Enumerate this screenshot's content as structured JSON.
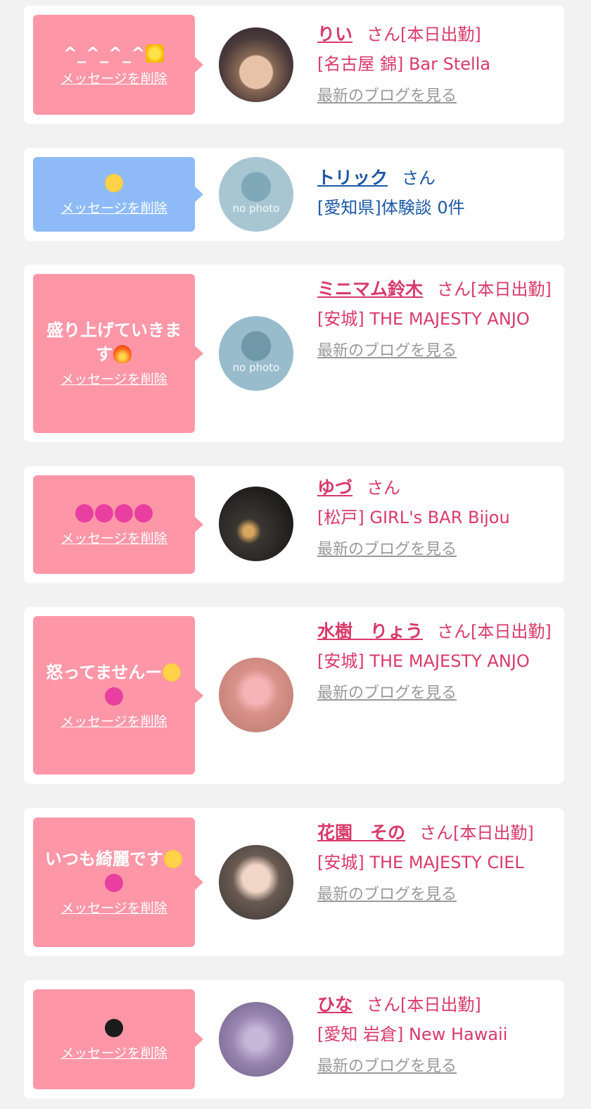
{
  "delete_label": "メッセージを削除",
  "san_label": "さん",
  "blog_label": "最新のブログを見る",
  "no_photo_label": "no photo",
  "cards": [
    {
      "message": "^_^_^_^",
      "emoji": "star",
      "name": "りい",
      "suffix": "[本日出勤]",
      "shop": "[名古屋 錦] Bar Stella"
    },
    {
      "message": "",
      "emoji": "kiss",
      "name": "トリック",
      "suffix": "",
      "shop": "[愛知県]体験談 0件"
    },
    {
      "message": "盛り上げていきます",
      "emoji": "fire",
      "name": "ミニマム鈴木",
      "suffix": "[本日出勤]",
      "shop": "[安城] THE MAJESTY ANJO"
    },
    {
      "message": "",
      "emoji": "hearts",
      "name": "ゆづ",
      "suffix": "",
      "shop": "[松戸] GIRL's BAR Bijou"
    },
    {
      "message": "怒ってませんー",
      "emoji": "pleading-heart",
      "name": "水樹　りょう",
      "suffix": "[本日出勤]",
      "shop": "[安城] THE MAJESTY ANJO"
    },
    {
      "message": "いつも綺麗です",
      "emoji": "smile-heart",
      "name": "花園　その",
      "suffix": "[本日出勤]",
      "shop": "[安城] THE MAJESTY CIEL"
    },
    {
      "message": "",
      "emoji": "black-heart",
      "name": "ひな",
      "suffix": "[本日出勤]",
      "shop": "[愛知 岩倉] New Hawaii"
    }
  ]
}
